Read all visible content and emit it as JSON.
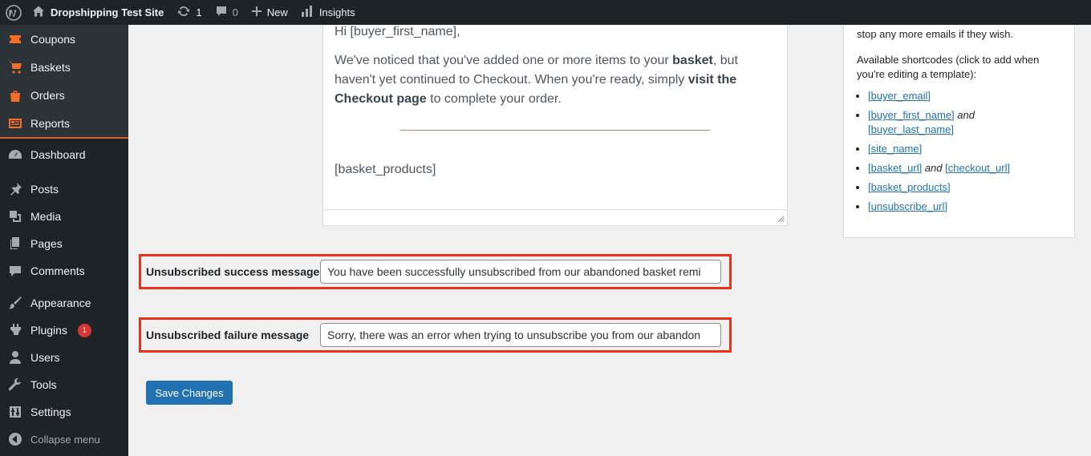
{
  "adminbar": {
    "site_name": "Dropshipping Test Site",
    "updates_count": "1",
    "comments_count": "0",
    "new_label": "New",
    "insights_label": "Insights"
  },
  "sidebar": {
    "woo_items": [
      {
        "label": "Coupons",
        "icon": "coupon-icon"
      },
      {
        "label": "Baskets",
        "icon": "cart-icon"
      },
      {
        "label": "Orders",
        "icon": "bag-icon"
      },
      {
        "label": "Reports",
        "icon": "reports-icon"
      }
    ],
    "items": [
      {
        "label": "Dashboard",
        "icon": "dashboard-icon"
      },
      {
        "label": "Posts",
        "icon": "pin-icon"
      },
      {
        "label": "Media",
        "icon": "media-icon"
      },
      {
        "label": "Pages",
        "icon": "pages-icon"
      },
      {
        "label": "Comments",
        "icon": "comment-icon"
      },
      {
        "label": "Appearance",
        "icon": "brush-icon"
      },
      {
        "label": "Plugins",
        "icon": "plugin-icon",
        "badge": "1"
      },
      {
        "label": "Users",
        "icon": "user-icon"
      },
      {
        "label": "Tools",
        "icon": "wrench-icon"
      },
      {
        "label": "Settings",
        "icon": "settings-icon"
      }
    ],
    "collapse_label": "Collapse menu"
  },
  "editor": {
    "greeting": "Hi [buyer_first_name],",
    "body_part1": "We've noticed that you've added one or more items to your ",
    "body_bold1": "basket",
    "body_part2": ", but haven't yet continued to Checkout. When you're ready, simply ",
    "body_bold2": "visit the Checkout page",
    "body_part3": " to complete your order.",
    "products_placeholder": "[basket_products]"
  },
  "shortcodes": {
    "intro_tail": "stop any more emails if they wish.",
    "available_text": "Available shortcodes (click to add when you're editing a template):",
    "items": {
      "buyer_email": "[buyer_email]",
      "buyer_first_name": "[buyer_first_name]",
      "and_word": "and",
      "buyer_last_name": "[buyer_last_name]",
      "site_name": "[site_name]",
      "basket_url": "[basket_url]",
      "checkout_url": "[checkout_url]",
      "basket_products": "[basket_products]",
      "unsubscribe_url": "[unsubscribe_url]"
    }
  },
  "fields": {
    "success_label": "Unsubscribed success message",
    "success_value": "You have been successfully unsubscribed from our abandoned basket remi",
    "failure_label": "Unsubscribed failure message",
    "failure_value": "Sorry, there was an error when trying to unsubscribe you from our abandon"
  },
  "save_label": "Save Changes",
  "colors": {
    "adminbar_bg": "#1d2327",
    "woo_accent": "#f56e28",
    "highlight_border": "#e8321e",
    "primary_button": "#2271b1"
  }
}
